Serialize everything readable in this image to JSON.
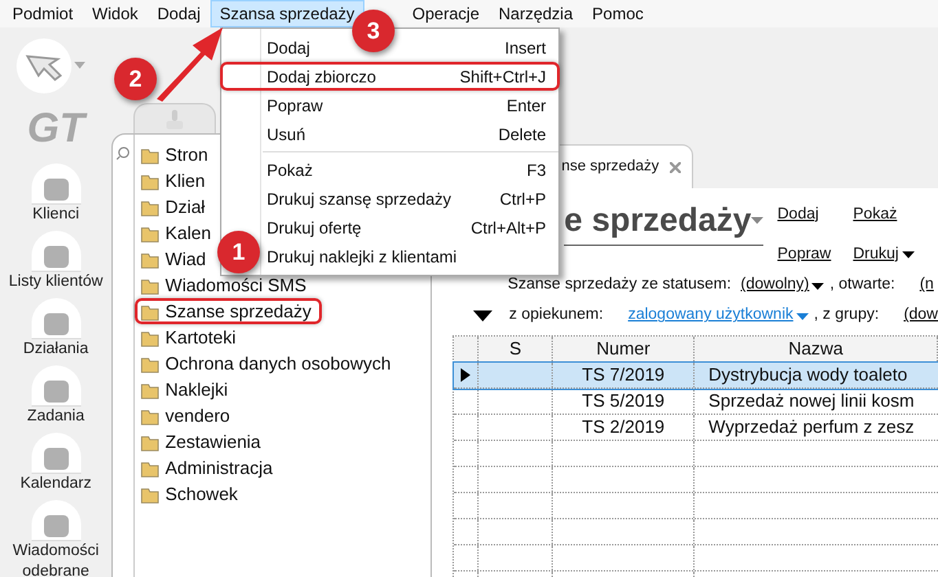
{
  "menu_bar": [
    {
      "label": "Podmiot",
      "selected": false
    },
    {
      "label": "Widok",
      "selected": false
    },
    {
      "label": "Dodaj",
      "selected": false
    },
    {
      "label": "Szansa sprzedaży",
      "selected": true
    },
    {
      "label": "Operacje",
      "selected": false
    },
    {
      "label": "Narzędzia",
      "selected": false
    },
    {
      "label": "Pomoc",
      "selected": false
    }
  ],
  "dropdown": [
    {
      "label": "Dodaj",
      "shortcut": "Insert",
      "highlighted": false
    },
    {
      "label": "Dodaj zbiorczo",
      "shortcut": "Shift+Ctrl+J",
      "highlighted": true
    },
    {
      "label": "Popraw",
      "shortcut": "Enter",
      "highlighted": false
    },
    {
      "label": "Usuń",
      "shortcut": "Delete",
      "highlighted": false,
      "separator_after": true
    },
    {
      "label": "Pokaż",
      "shortcut": "F3",
      "highlighted": false
    },
    {
      "label": "Drukuj szansę sprzedaży",
      "shortcut": "Ctrl+P",
      "highlighted": false
    },
    {
      "label": "Drukuj ofertę",
      "shortcut": "Ctrl+Alt+P",
      "highlighted": false
    },
    {
      "label": "Drukuj naklejki z klientami",
      "highlighted": false
    }
  ],
  "logo": "GT",
  "sidebar": [
    {
      "label": "Klienci"
    },
    {
      "label": "Listy klientów"
    },
    {
      "label": "Działania"
    },
    {
      "label": "Zadania"
    },
    {
      "label": "Kalendarz"
    },
    {
      "label": "Wiadomości odebrane"
    }
  ],
  "tree": [
    {
      "label": "Stron",
      "highlighted": false
    },
    {
      "label": "Klien",
      "highlighted": false
    },
    {
      "label": "Dział",
      "highlighted": false
    },
    {
      "label": "Kalen",
      "highlighted": false
    },
    {
      "label": "Wiad",
      "highlighted": false
    },
    {
      "label": "Wiadomości SMS",
      "highlighted": false
    },
    {
      "label": "Szanse sprzedaży",
      "highlighted": true
    },
    {
      "label": "Kartoteki",
      "highlighted": false
    },
    {
      "label": "Ochrona danych osobowych",
      "highlighted": false
    },
    {
      "label": "Naklejki",
      "highlighted": false
    },
    {
      "label": "vendero",
      "highlighted": false
    },
    {
      "label": "Zestawienia",
      "highlighted": false
    },
    {
      "label": "Administracja",
      "highlighted": false
    },
    {
      "label": "Schowek",
      "highlighted": false
    }
  ],
  "tab": {
    "label": "nse sprzedaży"
  },
  "heading": "e sprzedaży",
  "actions": [
    "Dodaj",
    "Pokaż",
    "Popraw",
    "Drukuj"
  ],
  "filters": {
    "status_label": "Szanse sprzedaży ze statusem:",
    "status_value": "(dowolny)",
    "open_label": ", otwarte:",
    "open_value": "(n",
    "owner_label": "z opiekunem:",
    "owner_value": "zalogowany użytkownik",
    "group_label": ", z grupy:",
    "group_value": "(dow"
  },
  "table": {
    "columns": [
      "S",
      "Numer",
      "Nazwa"
    ],
    "rows": [
      {
        "selected": true,
        "numer": "TS 7/2019",
        "nazwa": "Dystrybucja wody toaleto"
      },
      {
        "selected": false,
        "numer": "TS 5/2019",
        "nazwa": "Sprzedaż nowej linii kosm"
      },
      {
        "selected": false,
        "numer": "TS 2/2019",
        "nazwa": "Wyprzedaż perfum z zesz"
      }
    ]
  },
  "annotations": [
    {
      "label": "1"
    },
    {
      "label": "2"
    },
    {
      "label": "3"
    }
  ]
}
